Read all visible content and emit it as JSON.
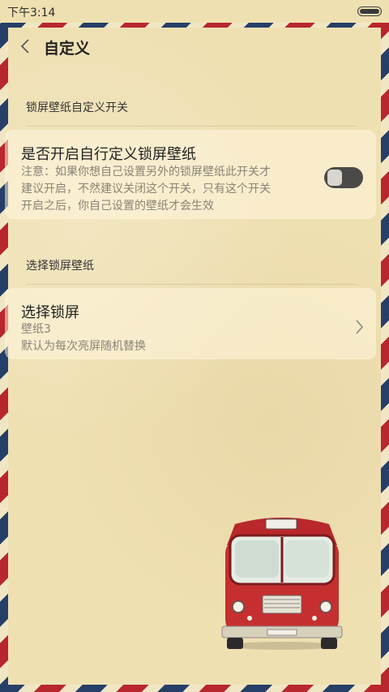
{
  "status_bar": {
    "time": "下午3:14"
  },
  "header": {
    "title": "自定义"
  },
  "section1": {
    "title": "锁屏壁纸自定义开关",
    "card": {
      "title": "是否开启自行定义锁屏壁纸",
      "desc_line1": "注意：如果你想自己设置另外的锁屏壁纸此开关才",
      "desc_line2": "建议开启，不然建议关闭这个开关，只有这个开关",
      "desc_line3": "开启之后，你自己设置的壁纸才会生效",
      "toggle_on": false
    }
  },
  "section2": {
    "title": "选择锁屏壁纸",
    "card": {
      "title": "选择锁屏",
      "value": "壁纸3",
      "desc": "默认为每次亮屏随机替换"
    }
  },
  "colors": {
    "stripe_red": "#b8262e",
    "stripe_blue": "#263f69",
    "paper": "#efe0b2",
    "toggle_track": "#4a4a48"
  },
  "icons": [
    "back-arrow-icon",
    "chevron-right-icon",
    "battery-icon",
    "red-bus-illustration"
  ]
}
